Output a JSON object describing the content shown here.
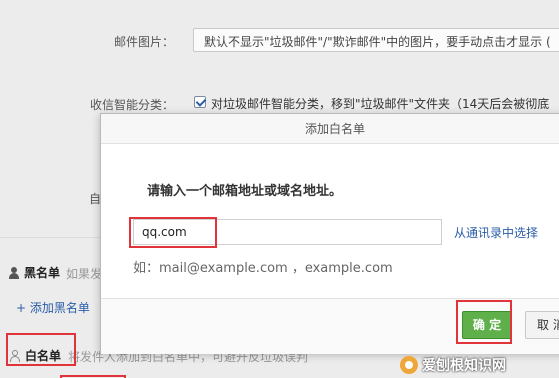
{
  "settings": {
    "mail_images_label": "邮件图片：",
    "mail_images_value": "默认不显示\"垃圾邮件\"/\"欺诈邮件\"中的图片，要手动点击才显示 (",
    "smart_classify_label": "收信智能分类：",
    "smart_classify_text": "对垃圾邮件智能分类，移到\"垃圾邮件\"文件夹（14天后会被彻底",
    "partial_label": "自",
    "blacklist_title": "黑名单",
    "blacklist_desc": "如果发",
    "add_blacklist_label": "+ 添加黑名单",
    "whitelist_title": "白名单",
    "whitelist_desc": "将发件人添加到白名单中，可避开反垃圾误判"
  },
  "dialog": {
    "title": "添加白名单",
    "prompt": "请输入一个邮箱地址或域名地址。",
    "input_value": "qq.com",
    "contacts_link": "从通讯录中选择",
    "hint": "如：mail@example.com ，example.com",
    "ok_label": "确 定",
    "cancel_label": "取 消"
  },
  "watermark": {
    "text": "爱刨根知识网"
  },
  "colors": {
    "accent_green": "#5fb04a",
    "link_blue": "#2a5da8",
    "annotation_red": "#e0343a"
  }
}
